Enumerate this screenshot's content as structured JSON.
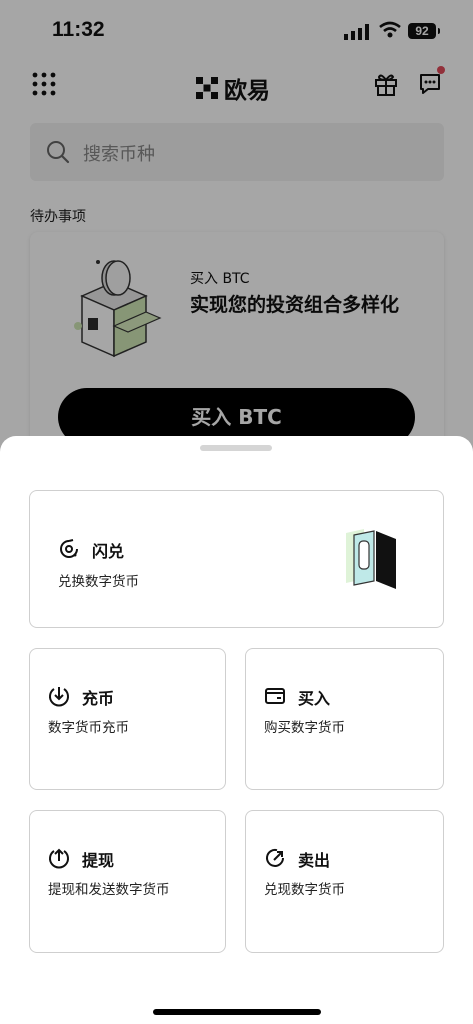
{
  "status": {
    "time": "11:32",
    "battery": "92"
  },
  "header": {
    "logo_text": "欧易"
  },
  "search": {
    "placeholder": "搜索币种"
  },
  "todo": {
    "section_title": "待办事项",
    "card_small": "买入 BTC",
    "card_big": "实现您的投资组合多样化",
    "button": "买入 BTC"
  },
  "sheet": {
    "flash": {
      "title": "闪兑",
      "subtitle": "兑换数字货币"
    },
    "deposit": {
      "title": "充币",
      "subtitle": "数字货币充币"
    },
    "buy": {
      "title": "买入",
      "subtitle": "购买数字货币"
    },
    "withdraw": {
      "title": "提现",
      "subtitle": "提现和发送数字货币"
    },
    "sell": {
      "title": "卖出",
      "subtitle": "兑现数字货币"
    }
  },
  "colors": {
    "accent": "#000000",
    "notification_dot": "#e04a5a",
    "overlay": "rgba(0,0,0,0.35)"
  }
}
